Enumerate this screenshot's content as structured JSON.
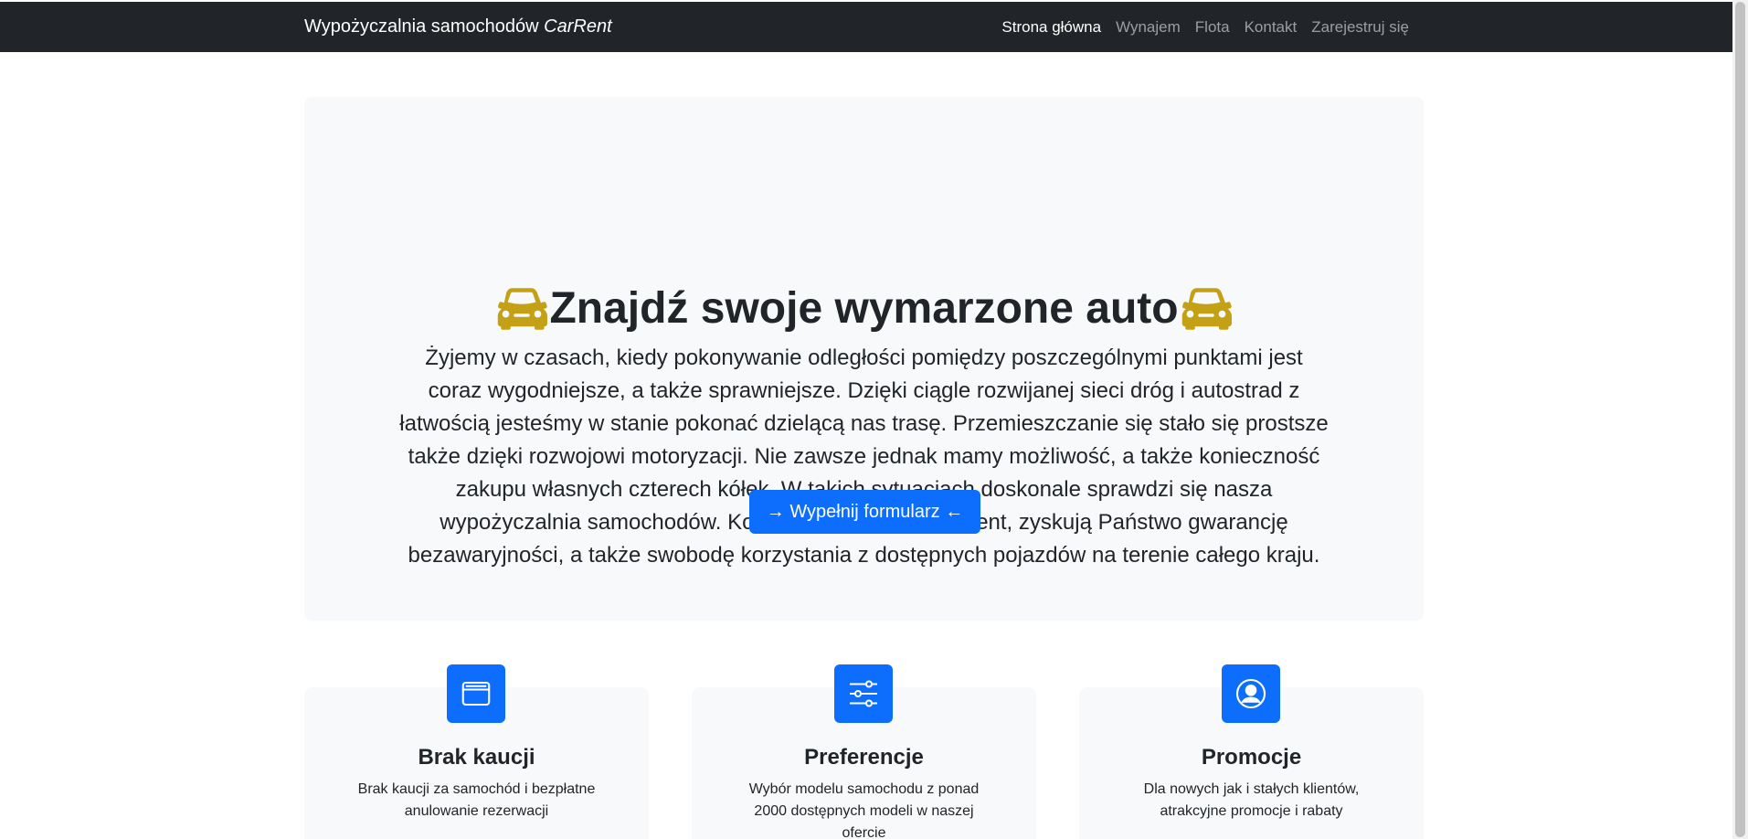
{
  "navbar": {
    "brand_prefix": "Wypożyczalnia samochodów",
    "brand_name": "CarRent",
    "items": [
      {
        "label": "Strona główna",
        "active": true
      },
      {
        "label": "Wynajem",
        "active": false
      },
      {
        "label": "Flota",
        "active": false
      },
      {
        "label": "Kontakt",
        "active": false
      },
      {
        "label": "Zarejestruj się",
        "active": false
      }
    ]
  },
  "hero": {
    "title": "Znajdź swoje wymarzone auto",
    "icon": "car-front-icon",
    "icon_color": "#c4a114",
    "text": "Żyjemy w czasach, kiedy pokonywanie odległości pomiędzy poszczególnymi punktami jest coraz wygodniejsze, a także sprawniejsze. Dzięki ciągle rozwijanej sieci dróg i autostrad z łatwością jesteśmy w stanie pokonać dzielącą nas trasę. Przemieszczanie się stało się prostsze także dzięki rozwojowi motoryzacji. Nie zawsze jednak mamy możliwość, a także konieczność zakupu własnych czterech kółek. W takich sytuacjach doskonale sprawdzi się nasza wypożyczalnia samochodów. Korzystając z oferty CarRent, zyskują Państwo gwarancję bezawaryjności, a także swobodę korzystania z dostępnych pojazdów na terenie całego kraju.",
    "button_label": "→ Wypełnij formularz ←"
  },
  "features": [
    {
      "icon": "wallet-icon",
      "title": "Brak kaucji",
      "text": "Brak kaucji za samochód i bezpłatne anulowanie rezerwacji"
    },
    {
      "icon": "sliders-icon",
      "title": "Preferencje",
      "text": "Wybór modelu samochodu z ponad 2000 dostępnych modeli w naszej ofercie"
    },
    {
      "icon": "person-circle-icon",
      "title": "Promocje",
      "text": "Dla nowych jak i stałych klientów, atrakcyjne promocje i rabaty"
    }
  ],
  "colors": {
    "navbar_bg": "#212529",
    "hero_bg": "#f8f9fa",
    "primary": "#0d6efd",
    "car_icon": "#c4a114"
  }
}
